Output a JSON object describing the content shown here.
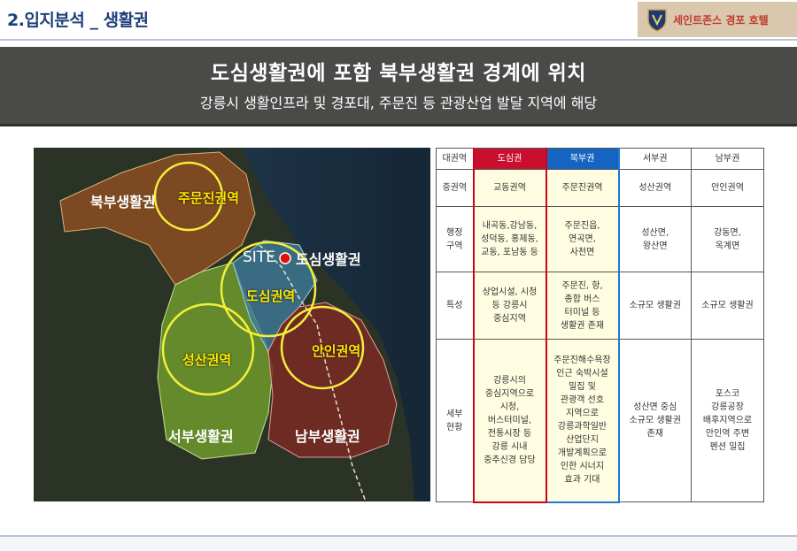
{
  "header": {
    "title": "2.입지분석 _ 생활권",
    "brand_name": "세인트존스 경포 호텔"
  },
  "banner": {
    "headline": "도심생활권에 포함 북부생활권 경계에 위치",
    "subtitle": "강릉시 생활인프라 및 경포대, 주문진 등 관광산업 발달 지역에 해당"
  },
  "map": {
    "labels": {
      "north": "북부생활권",
      "jumunjin": "주문진권역",
      "site": "SITE",
      "dosim_area": "도심생활권",
      "dosim_circle": "도심권역",
      "seongsan": "성산권역",
      "anin": "안인권역",
      "west": "서부생활권",
      "south": "남부생활권"
    },
    "colors": {
      "north": "#8b4e22",
      "west": "#6f9a2e",
      "south": "#7a2a25",
      "dosim": "#3d7a9a",
      "circle": "#f4ef3a",
      "site_dot": "#e01010"
    }
  },
  "table": {
    "row_labels": {
      "major": "대권역",
      "mid": "중권역",
      "admin": "행정\n구역",
      "feature": "특성",
      "detail": "세부\n현황"
    },
    "columns": [
      {
        "name": "도심권",
        "mid": "교동권역",
        "admin": "내곡동,강남동,\n성덕동, 홍제동,\n교동, 포남동 등",
        "feature": "상업시설, 시청\n등 강릉시\n중심지역",
        "detail": "강릉시의\n중심지역으로\n시청,\n버스터미널,\n전통시장 등\n강릉 시내\n중추신경 담당"
      },
      {
        "name": "북부권",
        "mid": "주문진권역",
        "admin": "주문진읍,\n연곡면,\n사천면",
        "feature": "주문진, 항,\n종합 버스\n터미널 등\n생활권 존재",
        "detail": "주문진해수욕장\n인근 숙박시설\n밀집 및\n관광객 선호\n지역으로\n강릉과학일반\n산업단지\n개발계획으로\n인한 시너지\n효과 기대"
      },
      {
        "name": "서부권",
        "mid": "성산권역",
        "admin": "성산면,\n왕산면",
        "feature": "소규모 생활권",
        "detail": "성산면 중심\n소규모 생활권\n존재"
      },
      {
        "name": "남부권",
        "mid": "안인권역",
        "admin": "강동면,\n옥계면",
        "feature": "소규모 생활권",
        "detail": "포스코\n강릉공장\n배후지역으로\n안인역 주변\n펜션 밀집"
      }
    ]
  }
}
